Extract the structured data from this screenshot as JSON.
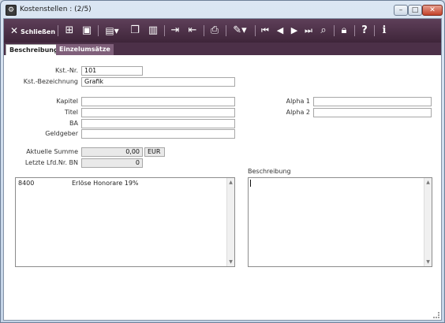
{
  "window": {
    "title": "Kostenstellen : (2/5)",
    "controls": {
      "minimize": "–",
      "maximize": "□",
      "close": "✕"
    }
  },
  "toolbar": {
    "close_label": "Schließen",
    "icons": [
      "new-record-icon",
      "save-icon",
      "document-icon",
      "copy-icon",
      "delete-icon",
      "import-icon",
      "export-icon",
      "print-icon",
      "attach-icon",
      "first-record-icon",
      "previous-record-icon",
      "next-record-icon",
      "last-record-icon",
      "search-icon",
      "lock-icon",
      "help-icon",
      "info-icon"
    ]
  },
  "tabs": [
    {
      "label": "Beschreibung",
      "active": true
    },
    {
      "label": "Einzelumsätze",
      "active": false
    }
  ],
  "form": {
    "kst_nr_label": "Kst.-Nr.",
    "kst_nr_value": "101",
    "kst_bez_label": "Kst.-Bezeichnung",
    "kst_bez_value": "Grafik",
    "kapitel_label": "Kapitel",
    "kapitel_value": "",
    "titel_label": "Titel",
    "titel_value": "",
    "ba_label": "BA",
    "ba_value": "",
    "geldgeber_label": "Geldgeber",
    "geldgeber_value": "",
    "alpha1_label": "Alpha 1",
    "alpha1_value": "",
    "alpha2_label": "Alpha 2",
    "alpha2_value": "",
    "summe_label": "Aktuelle Summe",
    "summe_value": "0,00",
    "summe_unit": "EUR",
    "lfd_label": "Letzte Lfd.Nr. BN",
    "lfd_value": "0",
    "beschreibung_label": "Beschreibung",
    "beschreibung_value": ""
  },
  "list": {
    "rows": [
      {
        "code": "8400",
        "text": "Erlöse Honorare 19%"
      }
    ]
  },
  "colors": {
    "toolbar": "#4c3048",
    "window_frame": "#c3d3e6"
  }
}
